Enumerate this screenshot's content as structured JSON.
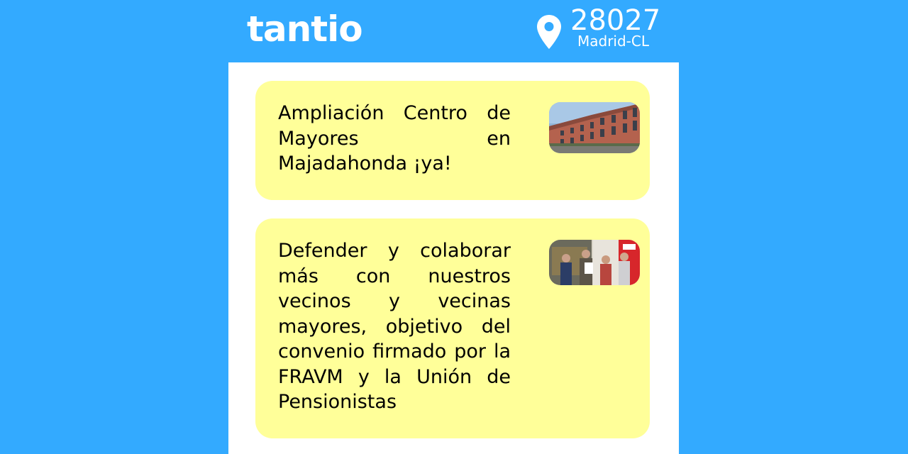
{
  "header": {
    "logo": "tantio",
    "location": {
      "postcode": "28027",
      "city": "Madrid-CL",
      "icon": "map-pin-icon"
    }
  },
  "colors": {
    "background": "#33aaff",
    "card": "#ffff99",
    "panel": "#ffffff"
  },
  "news": [
    {
      "title": "Ampliación Centro de Mayores en Majadahonda ¡ya!",
      "image": "building-photo"
    },
    {
      "title": "Defender y colaborar más con nuestros vecinos y vecinas mayores, objetivo del convenio firmado por la FRAVM y la Unión de Pensionistas",
      "image": "group-photo"
    }
  ]
}
